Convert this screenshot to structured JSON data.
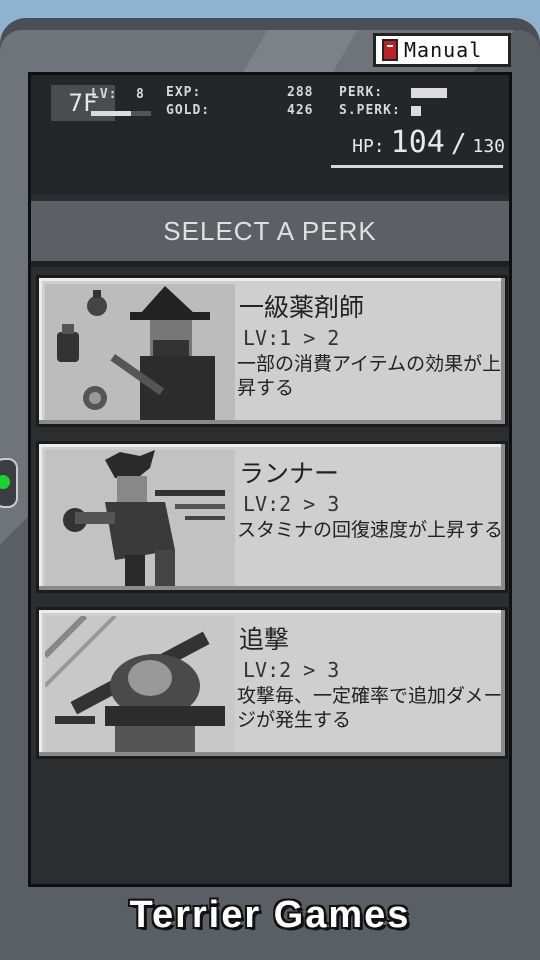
{
  "manual_label": "Manual",
  "status": {
    "floor": "7F",
    "lv_label": "LV:",
    "lv_value": "8",
    "exp_label": "EXP:",
    "exp_value": "288",
    "gold_label": "GOLD:",
    "gold_value": "426",
    "perk_label": "PERK:",
    "sperk_label": "S.PERK:",
    "hp_label": "HP:",
    "hp_value": "104",
    "hp_sep": "/",
    "hp_max": "130"
  },
  "title": "SELECT A PERK",
  "perks": [
    {
      "name": "一級薬剤師",
      "level": "LV:1 > 2",
      "desc": "一部の消費アイテムの効果が上昇する",
      "image": "witch-alchemist-portrait"
    },
    {
      "name": "ランナー",
      "level": "LV:2 > 3",
      "desc": "スタミナの回復速度が上昇する",
      "image": "running-fighter-portrait"
    },
    {
      "name": "追撃",
      "level": "LV:2 > 3",
      "desc": "攻撃毎、一定確率で追加ダメージが発生する",
      "image": "sword-attack-portrait"
    }
  ],
  "footer": "Terrier Games",
  "colors": {
    "led": "#1fd12f",
    "card": "#cfcfcf",
    "screen": "#2b2d30"
  }
}
